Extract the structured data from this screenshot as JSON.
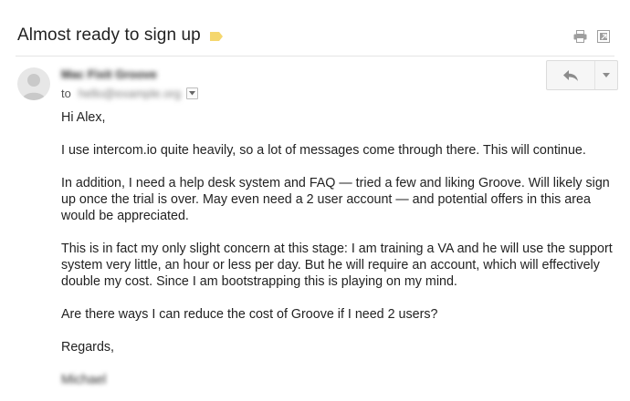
{
  "email": {
    "subject": "Almost ready to sign up",
    "label_color": "#f5d76e",
    "sender_name": "Mac Fixit Groove",
    "to_label": "to",
    "recipient": "hello@example.org",
    "body": [
      "Hi Alex,",
      "I use intercom.io quite heavily, so a lot of messages come through there. This will continue.",
      "In addition, I need a help desk system and FAQ — tried a few and liking Groove. Will likely sign up once the trial is over. May even need a 2 user account — and potential offers in this area would be appreciated.",
      "This is in fact my only slight concern at this stage: I am training a VA and he will use the support system very little, an hour or less per day. But he will require an account, which will effectively double my cost. Since I am bootstrapping this is playing on my mind.",
      "Are there ways I can reduce the cost of Groove if I need 2 users?"
    ],
    "signoff": "Regards,",
    "signature": "Michael"
  },
  "icons": {
    "label": "label-tag-icon",
    "print": "print-icon",
    "new_window": "new-window-icon",
    "reply": "reply-icon",
    "more": "chevron-down-icon",
    "details": "show-details-icon",
    "avatar": "avatar-icon"
  }
}
